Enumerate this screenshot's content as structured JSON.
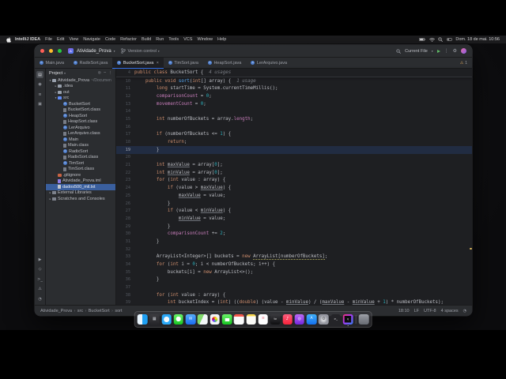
{
  "colors": {
    "accent": "#3574f0",
    "selection": "#3a5f9e",
    "caret_line": "rgba(56,118,255,0.15)",
    "warning": "#d6a45c"
  },
  "menu_bar": {
    "items": [
      "IntelliJ IDEA",
      "File",
      "Edit",
      "View",
      "Navigate",
      "Code",
      "Refactor",
      "Build",
      "Run",
      "Tools",
      "VCS",
      "Window",
      "Help"
    ],
    "status_icons": [
      "battery-icon",
      "wifi-icon",
      "search-icon",
      "control-center-icon"
    ],
    "clock": "Dom. 18 de mai. 10:56"
  },
  "window": {
    "title_bar": {
      "project_name": "Atividade_Prova",
      "vcs_label": "Version control",
      "run_config": "Current File"
    },
    "tab_bar": {
      "tabs": [
        {
          "label": "Main.java",
          "active": false
        },
        {
          "label": "RadixSort.java",
          "active": false
        },
        {
          "label": "BucketSort.java",
          "active": true
        },
        {
          "label": "TimSort.java",
          "active": false
        },
        {
          "label": "HeapSort.java",
          "active": false
        },
        {
          "label": "LerArquivo.java",
          "active": false
        }
      ],
      "warning_count": "1"
    },
    "tool_strip": {
      "top": [
        {
          "name": "project-tool-icon",
          "glyph": "▤",
          "active": true
        },
        {
          "name": "commit-tool-icon",
          "glyph": "◉",
          "active": false
        },
        {
          "name": "structure-tool-icon",
          "glyph": "≡",
          "active": false
        },
        {
          "name": "bookmarks-tool-icon",
          "glyph": "▣",
          "active": false
        }
      ],
      "bottom": [
        {
          "name": "run-tool-icon",
          "glyph": "▶",
          "active": false
        },
        {
          "name": "debug-tool-icon",
          "glyph": "◇",
          "active": false
        },
        {
          "name": "terminal-tool-icon",
          "glyph": ">_",
          "active": false
        },
        {
          "name": "problems-tool-icon",
          "glyph": "⚠",
          "active": false
        },
        {
          "name": "notifications-tool-icon",
          "glyph": "◔",
          "active": false
        }
      ]
    }
  },
  "project_panel": {
    "title": "Project",
    "header_icons": [
      {
        "name": "locate-file-icon",
        "glyph": "◎"
      },
      {
        "name": "collapse-all-icon",
        "glyph": "−"
      },
      {
        "name": "more-icon",
        "glyph": "⋮"
      }
    ],
    "tree": [
      {
        "label": "Atividade_Prova",
        "suffix": "~/Documen",
        "depth": 0,
        "chevron": "expanded",
        "icon": "project"
      },
      {
        "label": ".idea",
        "depth": 1,
        "chevron": "collapsed",
        "icon": "folder"
      },
      {
        "label": "out",
        "depth": 1,
        "chevron": "collapsed",
        "icon": "folder"
      },
      {
        "label": "src",
        "depth": 1,
        "chevron": "expanded",
        "icon": "src"
      },
      {
        "label": "BucketSort",
        "depth": 2,
        "icon": "class"
      },
      {
        "label": "BucketSort.class",
        "depth": 2,
        "icon": "classfile"
      },
      {
        "label": "HeapSort",
        "depth": 2,
        "icon": "class"
      },
      {
        "label": "HeapSort.class",
        "depth": 2,
        "icon": "classfile"
      },
      {
        "label": "LerArquivo",
        "depth": 2,
        "icon": "class"
      },
      {
        "label": "LerArquivo.class",
        "depth": 2,
        "icon": "classfile"
      },
      {
        "label": "Main",
        "depth": 2,
        "icon": "class"
      },
      {
        "label": "Main.class",
        "depth": 2,
        "icon": "classfile"
      },
      {
        "label": "RadixSort",
        "depth": 2,
        "icon": "class"
      },
      {
        "label": "RadixSort.class",
        "depth": 2,
        "icon": "classfile"
      },
      {
        "label": "TimSort",
        "depth": 2,
        "icon": "class"
      },
      {
        "label": "TimSort.class",
        "depth": 2,
        "icon": "classfile"
      },
      {
        "label": ".gitignore",
        "depth": 1,
        "icon": "git"
      },
      {
        "label": "Atividade_Prova.iml",
        "depth": 1,
        "icon": "iml"
      },
      {
        "label": "dados500_mil.txt",
        "depth": 1,
        "icon": "txt",
        "selected": true
      },
      {
        "label": "External Libraries",
        "depth": 0,
        "chevron": "collapsed",
        "icon": "lib"
      },
      {
        "label": "Scratches and Consoles",
        "depth": 0,
        "chevron": "collapsed",
        "icon": "scratch"
      }
    ]
  },
  "editor": {
    "sticky_line": {
      "n": "4",
      "i": 0,
      "t": [
        [
          "k",
          "public"
        ],
        [
          "d",
          " "
        ],
        [
          "k",
          "class"
        ],
        [
          "d",
          " "
        ],
        [
          "d",
          "BucketSort"
        ],
        [
          "d",
          " {"
        ],
        [
          "g",
          "  4 usages"
        ]
      ]
    },
    "lines": [
      {
        "n": "10",
        "i": 1,
        "t": [
          [
            "k",
            "public"
          ],
          [
            "d",
            " "
          ],
          [
            "k",
            "void"
          ],
          [
            "d",
            " "
          ],
          [
            "m",
            "sort"
          ],
          [
            "d",
            "("
          ],
          [
            "k",
            "int"
          ],
          [
            "d",
            "[] array) {"
          ],
          [
            "g",
            "  1 usage"
          ]
        ]
      },
      {
        "n": "11",
        "i": 2,
        "t": [
          [
            "k",
            "long"
          ],
          [
            "d",
            " startTime = System.currentTimeMillis();"
          ]
        ]
      },
      {
        "n": "12",
        "i": 2,
        "t": [
          [
            "f",
            "comparisonCount"
          ],
          [
            "d",
            " = "
          ],
          [
            "n",
            "0"
          ],
          [
            "d",
            ";"
          ]
        ]
      },
      {
        "n": "13",
        "i": 2,
        "t": [
          [
            "f",
            "movementCount"
          ],
          [
            "d",
            " = "
          ],
          [
            "n",
            "0"
          ],
          [
            "d",
            ";"
          ]
        ]
      },
      {
        "n": "14",
        "i": 0,
        "t": []
      },
      {
        "n": "15",
        "i": 2,
        "t": [
          [
            "k",
            "int"
          ],
          [
            "d",
            " numberOfBuckets = array."
          ],
          [
            "f",
            "length"
          ],
          [
            "d",
            ";"
          ]
        ]
      },
      {
        "n": "16",
        "i": 0,
        "t": []
      },
      {
        "n": "17",
        "i": 2,
        "t": [
          [
            "k",
            "if"
          ],
          [
            "d",
            " (numberOfBuckets <= "
          ],
          [
            "n",
            "1"
          ],
          [
            "d",
            ") {"
          ]
        ]
      },
      {
        "n": "18",
        "i": 3,
        "t": [
          [
            "k",
            "return"
          ],
          [
            "d",
            ";"
          ]
        ]
      },
      {
        "n": "19",
        "i": 2,
        "hl": true,
        "t": [
          [
            "d",
            "}"
          ]
        ]
      },
      {
        "n": "20",
        "i": 0,
        "t": []
      },
      {
        "n": "21",
        "i": 2,
        "t": [
          [
            "k",
            "int"
          ],
          [
            "d",
            " "
          ],
          [
            "u",
            "maxValue"
          ],
          [
            "d",
            " = array["
          ],
          [
            "n",
            "0"
          ],
          [
            "d",
            "];"
          ]
        ]
      },
      {
        "n": "22",
        "i": 2,
        "t": [
          [
            "k",
            "int"
          ],
          [
            "d",
            " "
          ],
          [
            "u",
            "minValue"
          ],
          [
            "d",
            " = array["
          ],
          [
            "n",
            "0"
          ],
          [
            "d",
            "];"
          ]
        ]
      },
      {
        "n": "23",
        "i": 2,
        "t": [
          [
            "k",
            "for"
          ],
          [
            "d",
            " ("
          ],
          [
            "k",
            "int"
          ],
          [
            "d",
            " value : array) {"
          ]
        ]
      },
      {
        "n": "24",
        "i": 3,
        "t": [
          [
            "k",
            "if"
          ],
          [
            "d",
            " (value > "
          ],
          [
            "u",
            "maxValue"
          ],
          [
            "d",
            ") {"
          ]
        ]
      },
      {
        "n": "25",
        "i": 4,
        "t": [
          [
            "u",
            "maxValue"
          ],
          [
            "d",
            " = value;"
          ]
        ]
      },
      {
        "n": "26",
        "i": 3,
        "t": [
          [
            "d",
            "}"
          ]
        ]
      },
      {
        "n": "27",
        "i": 3,
        "t": [
          [
            "k",
            "if"
          ],
          [
            "d",
            " (value < "
          ],
          [
            "u",
            "minValue"
          ],
          [
            "d",
            ") {"
          ]
        ]
      },
      {
        "n": "28",
        "i": 4,
        "t": [
          [
            "u",
            "minValue"
          ],
          [
            "d",
            " = value;"
          ]
        ]
      },
      {
        "n": "29",
        "i": 3,
        "t": [
          [
            "d",
            "}"
          ]
        ]
      },
      {
        "n": "30",
        "i": 3,
        "t": [
          [
            "f",
            "comparisonCount"
          ],
          [
            "d",
            " += "
          ],
          [
            "n",
            "2"
          ],
          [
            "d",
            ";"
          ]
        ]
      },
      {
        "n": "31",
        "i": 2,
        "t": [
          [
            "d",
            "}"
          ]
        ]
      },
      {
        "n": "32",
        "i": 0,
        "t": []
      },
      {
        "n": "33",
        "i": 2,
        "t": [
          [
            "d",
            "ArrayList<Integer>[] buckets = "
          ],
          [
            "k",
            "new"
          ],
          [
            "d",
            " "
          ],
          [
            "w",
            "ArrayList[numberOfBuckets]"
          ],
          [
            "d",
            ";"
          ]
        ]
      },
      {
        "n": "34",
        "i": 2,
        "t": [
          [
            "k",
            "for"
          ],
          [
            "d",
            " ("
          ],
          [
            "k",
            "int"
          ],
          [
            "d",
            " i = "
          ],
          [
            "n",
            "0"
          ],
          [
            "d",
            "; i < numberOfBuckets; i++) {"
          ]
        ]
      },
      {
        "n": "35",
        "i": 3,
        "t": [
          [
            "d",
            "buckets[i] = "
          ],
          [
            "k",
            "new"
          ],
          [
            "d",
            " ArrayList<>();"
          ]
        ]
      },
      {
        "n": "36",
        "i": 2,
        "t": [
          [
            "d",
            "}"
          ]
        ]
      },
      {
        "n": "37",
        "i": 0,
        "t": []
      },
      {
        "n": "38",
        "i": 2,
        "t": [
          [
            "k",
            "for"
          ],
          [
            "d",
            " ("
          ],
          [
            "k",
            "int"
          ],
          [
            "d",
            " value : array) {"
          ]
        ]
      },
      {
        "n": "39",
        "i": 3,
        "t": [
          [
            "k",
            "int"
          ],
          [
            "d",
            " bucketIndex = ("
          ],
          [
            "k",
            "int"
          ],
          [
            "d",
            ") (("
          ],
          [
            "k",
            "double"
          ],
          [
            "d",
            ") (value - "
          ],
          [
            "u",
            "minValue"
          ],
          [
            "d",
            ") / ("
          ],
          [
            "u",
            "maxValue"
          ],
          [
            "d",
            " - "
          ],
          [
            "u",
            "minValue"
          ],
          [
            "d",
            " + "
          ],
          [
            "n",
            "1"
          ],
          [
            "d",
            ") * numberOfBuckets);"
          ]
        ]
      }
    ]
  },
  "status_bar": {
    "crumbs": [
      "Atividade_Prova",
      "src",
      "BucketSort",
      "sort"
    ],
    "cursor": "18:10",
    "line_ending": "LF",
    "encoding": "UTF-8",
    "indent": "4 spaces"
  },
  "dock": {
    "apps": [
      {
        "id": "finder",
        "bg": "linear-gradient(90deg,#e9f5fd 0 50%,#1e9ff2 50% 100%)"
      },
      {
        "id": "launchpad",
        "bg": "linear-gradient(#3c3c40,#26262a)",
        "glyph": "▦",
        "glyph_color": "#cfd2d8"
      },
      {
        "id": "safari",
        "bg": "radial-gradient(circle at 50% 50%,#f4f8fb 0 3.4px,#2ba9f8 3.6px)"
      },
      {
        "id": "messages",
        "bg": "radial-gradient(circle at 50% 46%,#ffffff 0 3px,transparent 3.2px),linear-gradient(#6bf269,#17c522)"
      },
      {
        "id": "mail",
        "bg": "linear-gradient(#55adf9,#1a6cf1)",
        "glyph": "✉",
        "glyph_size": "5px"
      },
      {
        "id": "maps",
        "bg": "linear-gradient(115deg,#80d96b 0 45%,#f2f6f8 45%)"
      },
      {
        "id": "photos",
        "bg": "radial-gradient(circle at 50% 50%,transparent 0 3.4px,#f2f3f5 3.6px),conic-gradient(#f5a623,#f8e71c,#7ed321,#4a90d9,#9013fe,#d0021b,#f5a623)"
      },
      {
        "id": "facetime",
        "bg": "linear-gradient(#ffffff,#ffffff) 50% 50%/5.5px 4px no-repeat,linear-gradient(#6bf269,#17c522)"
      },
      {
        "id": "calendar",
        "bg": "linear-gradient(180deg,#f4584d 0 3px,#fafbfc 3px)"
      },
      {
        "id": "notes",
        "bg": "linear-gradient(180deg,#f8d64b 0 2.6px,#fcfcf9 2.6px)"
      },
      {
        "id": "reminders",
        "bg": "#fdfdfe",
        "glyph": "≡",
        "glyph_color": "#e8536a",
        "glyph_size": "4.5px"
      },
      {
        "id": "tv",
        "bg": "linear-gradient(#3a3a3e,#0f0f11)",
        "glyph": "tv",
        "glyph_size": "3.5px"
      },
      {
        "id": "music",
        "bg": "linear-gradient(#fd5d7e,#f62339)",
        "glyph": "♪",
        "glyph_size": "5.5px"
      },
      {
        "id": "podcasts",
        "bg": "linear-gradient(#bc6af5,#7326de)",
        "glyph": "◎",
        "glyph_size": "5px"
      },
      {
        "id": "appstore",
        "bg": "linear-gradient(#3fb1f9,#1470ef)",
        "glyph": "A",
        "glyph_size": "4.5px"
      },
      {
        "id": "settings",
        "bg": "radial-gradient(circle,#d5d6da 0 2px,#9597a0 5px)",
        "glyph": "⚙",
        "glyph_color": "#55565c",
        "glyph_size": "5.5px"
      },
      {
        "id": "terminal",
        "bg": "#242428",
        "glyph": ">_",
        "glyph_size": "3.5px"
      },
      {
        "id": "intellij",
        "bg": "linear-gradient(#0c0c0e,#0c0c0e) 50% 50%/8.5px 8.5px no-repeat,linear-gradient(135deg,#fe2e6d,#a73bf7 45%,#2f80f2)",
        "glyph": "IJ",
        "glyph_size": "3px",
        "running": true
      },
      {
        "id": "separator",
        "separator": true
      },
      {
        "id": "trash",
        "bg": "linear-gradient(rgba(215,220,228,.65),rgba(150,156,168,.6))"
      }
    ]
  }
}
